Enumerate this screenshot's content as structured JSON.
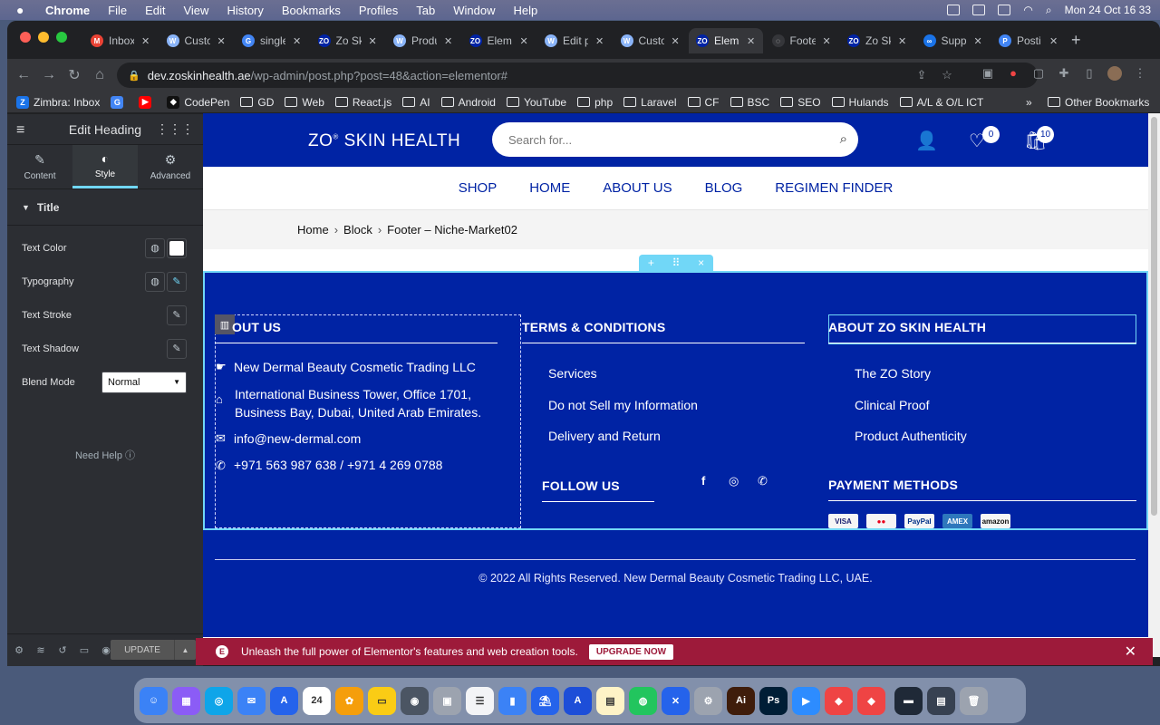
{
  "menubar": {
    "apple": "",
    "items": [
      "Chrome",
      "File",
      "Edit",
      "View",
      "History",
      "Bookmarks",
      "Profiles",
      "Tab",
      "Window",
      "Help"
    ],
    "clock": "Mon 24 Oct  16 33"
  },
  "tabs": [
    {
      "title": "Inbox",
      "fav": "M",
      "color": "#ea4335"
    },
    {
      "title": "Custo",
      "fav": "W",
      "color": "#8ab4f8"
    },
    {
      "title": "single",
      "fav": "G",
      "color": "#4285f4"
    },
    {
      "title": "Zo Sk",
      "fav": "ZO",
      "color": "#0023a4"
    },
    {
      "title": "Produ",
      "fav": "W",
      "color": "#8ab4f8"
    },
    {
      "title": "Elem",
      "fav": "ZO",
      "color": "#0023a4"
    },
    {
      "title": "Edit p",
      "fav": "W",
      "color": "#8ab4f8"
    },
    {
      "title": "Custo",
      "fav": "W",
      "color": "#8ab4f8"
    },
    {
      "title": "Elem",
      "fav": "ZO",
      "color": "#0023a4",
      "active": true
    },
    {
      "title": "Foote",
      "fav": "◌",
      "color": "#35363a"
    },
    {
      "title": "Zo Sk",
      "fav": "ZO",
      "color": "#0023a4"
    },
    {
      "title": "Supp",
      "fav": "∞",
      "color": "#1a73e8"
    },
    {
      "title": "Posti",
      "fav": "P",
      "color": "#4285f4"
    }
  ],
  "address": {
    "host": "dev.zoskinhealth.ae",
    "path": "/wp-admin/post.php?post=48&action=elementor#"
  },
  "bookmarks": [
    {
      "label": "Zimbra: Inbox",
      "type": "fav",
      "fav": "Z",
      "color": "#1a73e8"
    },
    {
      "label": "",
      "type": "fav",
      "fav": "G",
      "color": "#4285f4"
    },
    {
      "label": "",
      "type": "fav",
      "fav": "▶",
      "color": "#ff0000"
    },
    {
      "label": "CodePen",
      "type": "fav",
      "fav": "◆",
      "color": "#111"
    },
    {
      "label": "GD",
      "type": "folder"
    },
    {
      "label": "Web",
      "type": "folder"
    },
    {
      "label": "React.js",
      "type": "folder"
    },
    {
      "label": "AI",
      "type": "folder"
    },
    {
      "label": "Android",
      "type": "folder"
    },
    {
      "label": "YouTube",
      "type": "folder"
    },
    {
      "label": "php",
      "type": "folder"
    },
    {
      "label": "Laravel",
      "type": "folder"
    },
    {
      "label": "CF",
      "type": "folder"
    },
    {
      "label": "BSC",
      "type": "folder"
    },
    {
      "label": "SEO",
      "type": "folder"
    },
    {
      "label": "Hulands",
      "type": "folder"
    },
    {
      "label": "A/L & O/L ICT",
      "type": "folder"
    }
  ],
  "bookmarks_more": "»",
  "bookmarks_other": "Other Bookmarks",
  "panel": {
    "title": "Edit Heading",
    "tabs": [
      {
        "label": "Content",
        "icon": "✎"
      },
      {
        "label": "Style",
        "icon": "◐",
        "active": true
      },
      {
        "label": "Advanced",
        "icon": "⚙"
      }
    ],
    "section": "Title",
    "controls": {
      "text_color": "Text Color",
      "typography": "Typography",
      "text_stroke": "Text Stroke",
      "text_shadow": "Text Shadow",
      "blend_mode": "Blend Mode",
      "blend_value": "Normal"
    },
    "need_help": "Need Help",
    "update": "UPDATE"
  },
  "site": {
    "logo": "ZO",
    "logo_reg": "®",
    "logo_rest": " SKIN HEALTH",
    "search_placeholder": "Search for...",
    "wishlist_count": "0",
    "cart_count": "10",
    "nav": [
      "SHOP",
      "HOME",
      "ABOUT US",
      "BLOG",
      "REGIMEN FINDER"
    ],
    "breadcrumb": [
      "Home",
      "Block",
      "Footer – Niche-Market02"
    ],
    "footer": {
      "about_heading": "OUT US",
      "about_items": [
        "New Dermal Beauty Cosmetic Trading LLC",
        "International Business Tower, Office 1701,",
        "Business Bay, Dubai, United Arab Emirates.",
        "info@new-dermal.com",
        "+971 563 987 638 / +971 4 269 0788"
      ],
      "terms_heading": "TERMS & CONDITIONS",
      "terms_links": [
        "Services",
        "Do not Sell my Information",
        "Delivery and Return"
      ],
      "zo_heading": "ABOUT ZO SKIN HEALTH",
      "zo_links": [
        "The ZO Story",
        "Clinical Proof",
        "Product Authenticity"
      ],
      "follow_heading": "FOLLOW US",
      "payment_heading": "PAYMENT METHODS",
      "payments": [
        {
          "label": "VISA",
          "color": "#f5f5f5",
          "text": "#1a1f71"
        },
        {
          "label": "●●",
          "color": "#f5f5f5",
          "text": "#eb001b"
        },
        {
          "label": "PayPal",
          "color": "#f5f5f5",
          "text": "#003087"
        },
        {
          "label": "AMEX",
          "color": "#2e77bc",
          "text": "#ffffff"
        },
        {
          "label": "amazon",
          "color": "#f5f5f5",
          "text": "#111111"
        }
      ],
      "copyright": "© 2022 All Rights Reserved. New Dermal Beauty Cosmetic Trading LLC, UAE."
    }
  },
  "promo": {
    "text": "Unleash the full power of Elementor's features and web creation tools.",
    "button": "UPGRADE NOW"
  },
  "dock": [
    {
      "fav": "☺",
      "color": "#3b82f6"
    },
    {
      "fav": "▦",
      "color": "#8b5cf6"
    },
    {
      "fav": "◎",
      "color": "#0ea5e9"
    },
    {
      "fav": "✉",
      "color": "#3b82f6"
    },
    {
      "fav": "A",
      "color": "#2563eb"
    },
    {
      "fav": "24",
      "color": "#ffffff"
    },
    {
      "fav": "✿",
      "color": "#f59e0b"
    },
    {
      "fav": "▭",
      "color": "#facc15"
    },
    {
      "fav": "◉",
      "color": "#4b5563"
    },
    {
      "fav": "▣",
      "color": "#9ca3af"
    },
    {
      "fav": "☰",
      "color": "#f3f4f6"
    },
    {
      "fav": "▮",
      "color": "#3b82f6"
    },
    {
      "fav": "⛱",
      "color": "#2563eb"
    },
    {
      "fav": "A",
      "color": "#1d4ed8"
    },
    {
      "fav": "▤",
      "color": "#fef3c7"
    },
    {
      "fav": "◍",
      "color": "#22c55e"
    },
    {
      "fav": "✕",
      "color": "#2563eb"
    },
    {
      "fav": "⚙",
      "color": "#9ca3af"
    },
    {
      "fav": "Ai",
      "color": "#3f1d0b"
    },
    {
      "fav": "Ps",
      "color": "#001e36"
    },
    {
      "fav": "▶",
      "color": "#2d8cff"
    },
    {
      "fav": "◆",
      "color": "#ef4444"
    },
    {
      "fav": "◆",
      "color": "#ef4444"
    },
    {
      "fav": "▬",
      "color": "#1f2937"
    },
    {
      "fav": "▤",
      "color": "#374151"
    },
    {
      "fav": "🗑",
      "color": "#9ca3af"
    }
  ]
}
